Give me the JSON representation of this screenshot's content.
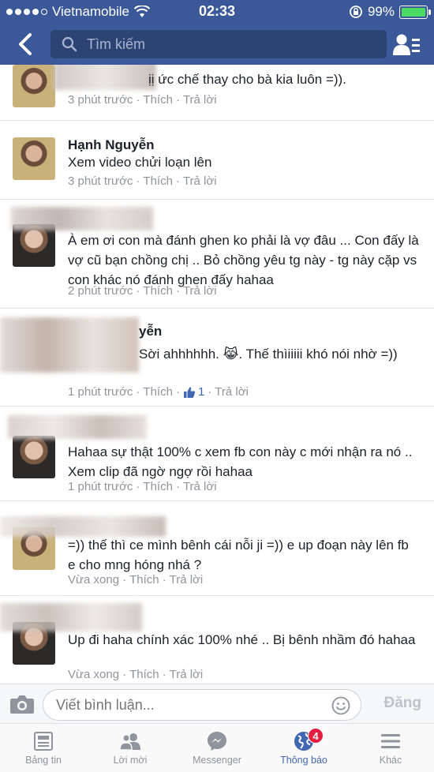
{
  "status_bar": {
    "carrier": "Vietnamobile",
    "time": "02:33",
    "battery": "99%",
    "battery_level": 0.99
  },
  "nav": {
    "search_placeholder": "Tìm kiếm"
  },
  "comments": [
    {
      "name": "",
      "text": "ịị ức chế thay cho bà kia luôn =)).",
      "time": "3 phút trước",
      "like": "Thích",
      "reply": "Trả lời"
    },
    {
      "name": "Hạnh Nguyễn",
      "text": "Xem video chửi loạn lên",
      "time": "3 phút trước",
      "like": "Thích",
      "reply": "Trả lời"
    },
    {
      "name": "",
      "text": "À em ơi con mà đánh ghen ko phải là vợ đâu ... Con đấy là vợ cũ bạn chồng chị .. Bỏ chồng yêu tg này - tg này cặp vs con khác nó đánh ghen đấy hahaa",
      "time": "2 phút trước",
      "like": "Thích",
      "reply": "Trả lời"
    },
    {
      "name": "yễn",
      "text": "Sời ahhhhhh. 😹. Thế thìiiiii khó nói nhờ =))",
      "time": "1 phút trước",
      "like": "Thích",
      "like_count": "1",
      "reply": "Trả lời"
    },
    {
      "name": "",
      "text": "Hahaa sự thật 100% c xem fb con này c mới nhận ra nó .. Xem clip đã ngờ ngợ rồi hahaa",
      "time": "1 phút trước",
      "like": "Thích",
      "reply": "Trả lời"
    },
    {
      "name": "",
      "text": "=)) thế thì ce mình bênh cái nỗi ji =)) e up đoạn này lên fb e cho mng hóng nhá ?",
      "time": "Vừa xong",
      "like": "Thích",
      "reply": "Trả lời"
    },
    {
      "name": "",
      "text": "Up đi haha chính xác 100% nhé .. Bị bênh nhầm đó hahaa",
      "time": "Vừa xong",
      "like": "Thích",
      "reply": "Trả lời"
    }
  ],
  "composer": {
    "placeholder": "Viết bình luận...",
    "post_label": "Đăng"
  },
  "tabs": [
    {
      "label": "Bảng tin",
      "icon": "news-feed-icon"
    },
    {
      "label": "Lời mời",
      "icon": "friend-requests-icon"
    },
    {
      "label": "Messenger",
      "icon": "messenger-icon"
    },
    {
      "label": "Thông báo",
      "icon": "globe-icon",
      "badge": "4"
    },
    {
      "label": "Khác",
      "icon": "menu-icon"
    }
  ],
  "colors": {
    "brand": "#3b5998",
    "active": "#4267b2",
    "badge": "#e41e3f"
  }
}
